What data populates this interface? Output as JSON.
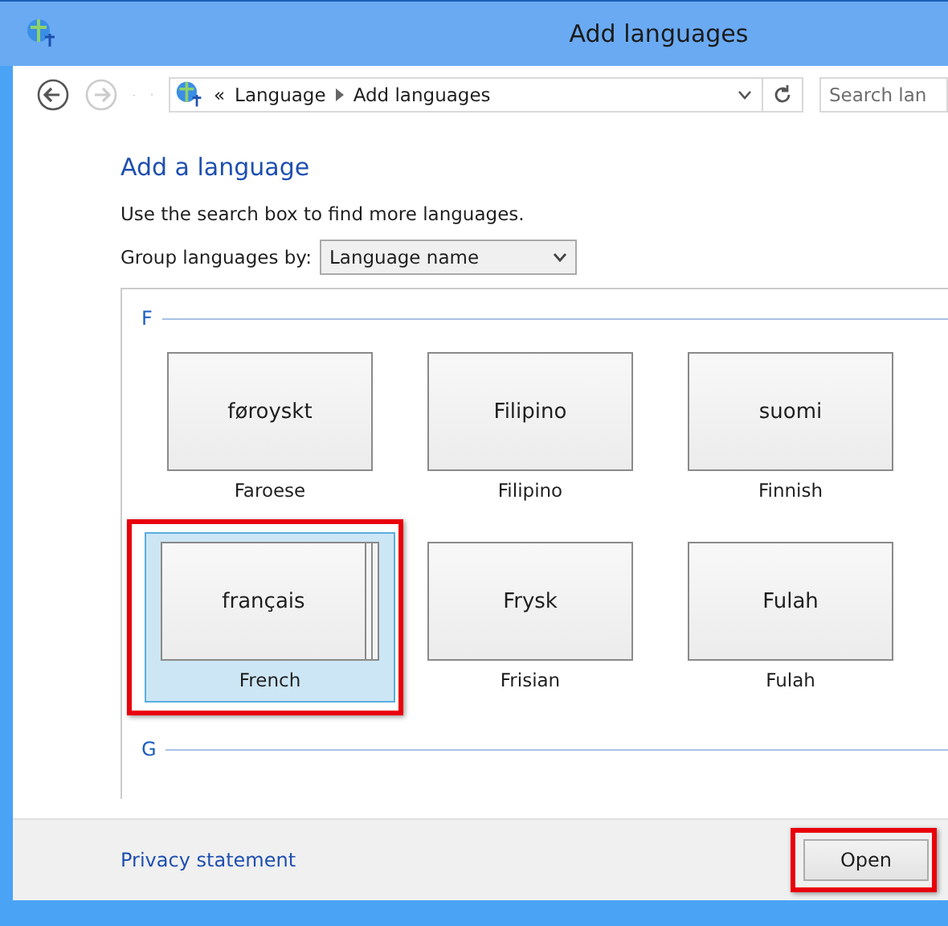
{
  "window": {
    "title": "Add languages"
  },
  "address_bar": {
    "overflow": "«",
    "path": [
      "Language",
      "Add languages"
    ]
  },
  "search": {
    "placeholder": "Search lan"
  },
  "heading": "Add a language",
  "hint": "Use the search box to find more languages.",
  "group_by": {
    "label": "Group languages by:",
    "value": "Language name"
  },
  "groups": [
    {
      "letter": "F",
      "languages": [
        {
          "native": "føroyskt",
          "english": "Faroese",
          "selected": false,
          "stacked": false,
          "highlighted": false
        },
        {
          "native": "Filipino",
          "english": "Filipino",
          "selected": false,
          "stacked": false,
          "highlighted": false
        },
        {
          "native": "suomi",
          "english": "Finnish",
          "selected": false,
          "stacked": false,
          "highlighted": false
        },
        {
          "native": "français",
          "english": "French",
          "selected": true,
          "stacked": true,
          "highlighted": true
        },
        {
          "native": "Frysk",
          "english": "Frisian",
          "selected": false,
          "stacked": false,
          "highlighted": false
        },
        {
          "native": "Fulah",
          "english": "Fulah",
          "selected": false,
          "stacked": false,
          "highlighted": false
        }
      ]
    },
    {
      "letter": "G"
    }
  ],
  "footer": {
    "link": "Privacy statement",
    "button": {
      "label": "Open",
      "highlighted": true
    }
  }
}
